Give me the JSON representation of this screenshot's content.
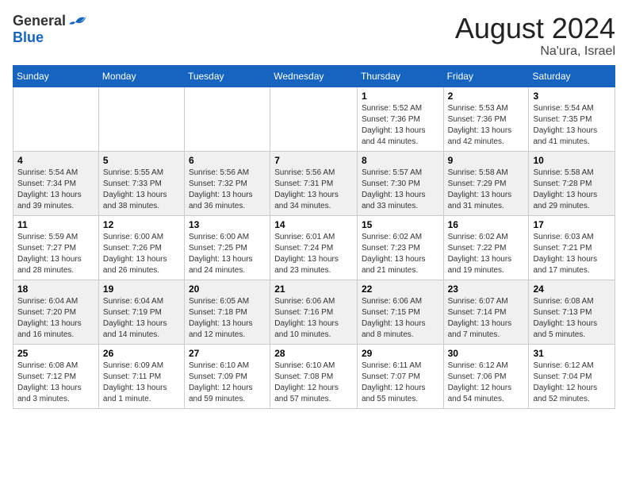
{
  "header": {
    "logo_general": "General",
    "logo_blue": "Blue",
    "month_year": "August 2024",
    "location": "Na'ura, Israel"
  },
  "weekdays": [
    "Sunday",
    "Monday",
    "Tuesday",
    "Wednesday",
    "Thursday",
    "Friday",
    "Saturday"
  ],
  "weeks": [
    [
      {
        "day": "",
        "detail": ""
      },
      {
        "day": "",
        "detail": ""
      },
      {
        "day": "",
        "detail": ""
      },
      {
        "day": "",
        "detail": ""
      },
      {
        "day": "1",
        "detail": "Sunrise: 5:52 AM\nSunset: 7:36 PM\nDaylight: 13 hours\nand 44 minutes."
      },
      {
        "day": "2",
        "detail": "Sunrise: 5:53 AM\nSunset: 7:36 PM\nDaylight: 13 hours\nand 42 minutes."
      },
      {
        "day": "3",
        "detail": "Sunrise: 5:54 AM\nSunset: 7:35 PM\nDaylight: 13 hours\nand 41 minutes."
      }
    ],
    [
      {
        "day": "4",
        "detail": "Sunrise: 5:54 AM\nSunset: 7:34 PM\nDaylight: 13 hours\nand 39 minutes."
      },
      {
        "day": "5",
        "detail": "Sunrise: 5:55 AM\nSunset: 7:33 PM\nDaylight: 13 hours\nand 38 minutes."
      },
      {
        "day": "6",
        "detail": "Sunrise: 5:56 AM\nSunset: 7:32 PM\nDaylight: 13 hours\nand 36 minutes."
      },
      {
        "day": "7",
        "detail": "Sunrise: 5:56 AM\nSunset: 7:31 PM\nDaylight: 13 hours\nand 34 minutes."
      },
      {
        "day": "8",
        "detail": "Sunrise: 5:57 AM\nSunset: 7:30 PM\nDaylight: 13 hours\nand 33 minutes."
      },
      {
        "day": "9",
        "detail": "Sunrise: 5:58 AM\nSunset: 7:29 PM\nDaylight: 13 hours\nand 31 minutes."
      },
      {
        "day": "10",
        "detail": "Sunrise: 5:58 AM\nSunset: 7:28 PM\nDaylight: 13 hours\nand 29 minutes."
      }
    ],
    [
      {
        "day": "11",
        "detail": "Sunrise: 5:59 AM\nSunset: 7:27 PM\nDaylight: 13 hours\nand 28 minutes."
      },
      {
        "day": "12",
        "detail": "Sunrise: 6:00 AM\nSunset: 7:26 PM\nDaylight: 13 hours\nand 26 minutes."
      },
      {
        "day": "13",
        "detail": "Sunrise: 6:00 AM\nSunset: 7:25 PM\nDaylight: 13 hours\nand 24 minutes."
      },
      {
        "day": "14",
        "detail": "Sunrise: 6:01 AM\nSunset: 7:24 PM\nDaylight: 13 hours\nand 23 minutes."
      },
      {
        "day": "15",
        "detail": "Sunrise: 6:02 AM\nSunset: 7:23 PM\nDaylight: 13 hours\nand 21 minutes."
      },
      {
        "day": "16",
        "detail": "Sunrise: 6:02 AM\nSunset: 7:22 PM\nDaylight: 13 hours\nand 19 minutes."
      },
      {
        "day": "17",
        "detail": "Sunrise: 6:03 AM\nSunset: 7:21 PM\nDaylight: 13 hours\nand 17 minutes."
      }
    ],
    [
      {
        "day": "18",
        "detail": "Sunrise: 6:04 AM\nSunset: 7:20 PM\nDaylight: 13 hours\nand 16 minutes."
      },
      {
        "day": "19",
        "detail": "Sunrise: 6:04 AM\nSunset: 7:19 PM\nDaylight: 13 hours\nand 14 minutes."
      },
      {
        "day": "20",
        "detail": "Sunrise: 6:05 AM\nSunset: 7:18 PM\nDaylight: 13 hours\nand 12 minutes."
      },
      {
        "day": "21",
        "detail": "Sunrise: 6:06 AM\nSunset: 7:16 PM\nDaylight: 13 hours\nand 10 minutes."
      },
      {
        "day": "22",
        "detail": "Sunrise: 6:06 AM\nSunset: 7:15 PM\nDaylight: 13 hours\nand 8 minutes."
      },
      {
        "day": "23",
        "detail": "Sunrise: 6:07 AM\nSunset: 7:14 PM\nDaylight: 13 hours\nand 7 minutes."
      },
      {
        "day": "24",
        "detail": "Sunrise: 6:08 AM\nSunset: 7:13 PM\nDaylight: 13 hours\nand 5 minutes."
      }
    ],
    [
      {
        "day": "25",
        "detail": "Sunrise: 6:08 AM\nSunset: 7:12 PM\nDaylight: 13 hours\nand 3 minutes."
      },
      {
        "day": "26",
        "detail": "Sunrise: 6:09 AM\nSunset: 7:11 PM\nDaylight: 13 hours\nand 1 minute."
      },
      {
        "day": "27",
        "detail": "Sunrise: 6:10 AM\nSunset: 7:09 PM\nDaylight: 12 hours\nand 59 minutes."
      },
      {
        "day": "28",
        "detail": "Sunrise: 6:10 AM\nSunset: 7:08 PM\nDaylight: 12 hours\nand 57 minutes."
      },
      {
        "day": "29",
        "detail": "Sunrise: 6:11 AM\nSunset: 7:07 PM\nDaylight: 12 hours\nand 55 minutes."
      },
      {
        "day": "30",
        "detail": "Sunrise: 6:12 AM\nSunset: 7:06 PM\nDaylight: 12 hours\nand 54 minutes."
      },
      {
        "day": "31",
        "detail": "Sunrise: 6:12 AM\nSunset: 7:04 PM\nDaylight: 12 hours\nand 52 minutes."
      }
    ]
  ]
}
